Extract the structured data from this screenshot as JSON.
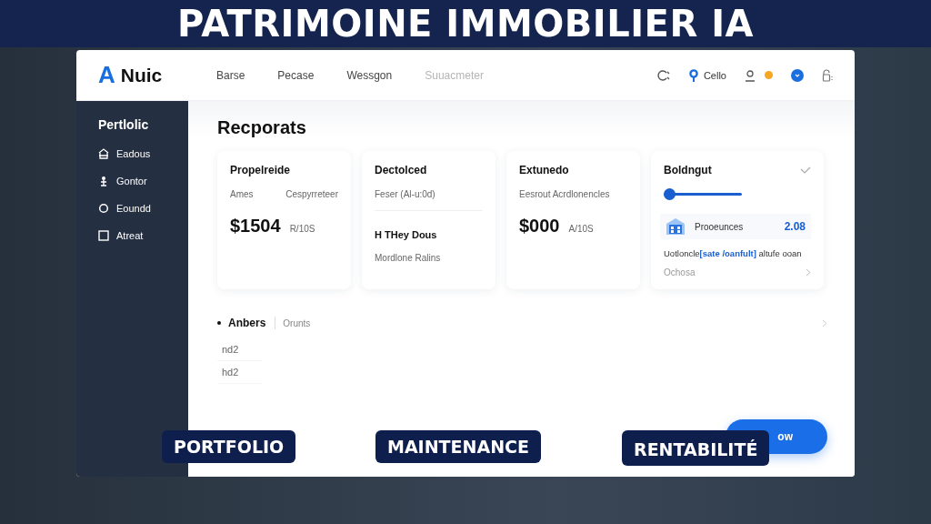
{
  "banner": {
    "title": "PATRIMOINE IMMOBILIER IA"
  },
  "header": {
    "logo_mark": "A",
    "logo_text": "Nuic",
    "nav": [
      {
        "label": "Barse",
        "disabled": false
      },
      {
        "label": "Pecase",
        "disabled": false
      },
      {
        "label": "Wessgon",
        "disabled": false
      },
      {
        "label": "Suuacmeter",
        "disabled": true
      }
    ],
    "location": "Cello"
  },
  "sidebar": {
    "title": "Pertlolic",
    "items": [
      {
        "label": "Eadous",
        "kind": "home"
      },
      {
        "label": "Gontor",
        "kind": "person"
      },
      {
        "label": "Eoundd",
        "kind": "circle"
      },
      {
        "label": "Atreat",
        "kind": "square"
      }
    ]
  },
  "main": {
    "heading": "Recporats",
    "cards": [
      {
        "kind": "stat",
        "title": "Propelreide",
        "sub_left": "Ames",
        "sub_right": "Cespyrreteer",
        "value": "$1504",
        "unit": "R/10S"
      },
      {
        "kind": "detail",
        "title": "Dectolced",
        "sub_left": "Feser (Al-u:0d)",
        "line": "H THey Dous",
        "note": "Mordlone Ralins"
      },
      {
        "kind": "stat",
        "title": "Extunedo",
        "sub_left": "Eesrout Acrdlonencles",
        "value": "$000",
        "unit": "A/10S"
      },
      {
        "kind": "slider",
        "title": "Boldngut",
        "level": 0.05,
        "item_label": "Prooeunces",
        "item_value": "2.08",
        "text": "Uotloncle**[sate /oanfult]** altufe ooan",
        "link": "Ochosa"
      }
    ],
    "list": {
      "title": "Anbers",
      "tab": "Orunts",
      "rows": [
        "nd2",
        "hd2"
      ]
    },
    "button": "ow"
  },
  "tags": [
    "PORTFOLIO",
    "MAINTENANCE",
    "RENTABILITÉ"
  ]
}
